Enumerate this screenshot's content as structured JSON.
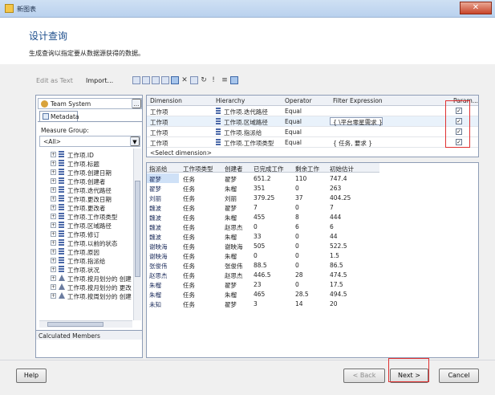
{
  "window": {
    "title": "新图表",
    "close_glyph": "✕"
  },
  "header": {
    "heading": "设计查询",
    "description": "生成查询以指定要从数据源获得的数据。"
  },
  "toolbar": {
    "edit_as_text": "Edit as Text",
    "import": "Import..."
  },
  "left_panel": {
    "cube_selector": "Team System",
    "tab_metadata": "Metadata",
    "measure_group_label": "Measure Group:",
    "measure_group_value": "<All>",
    "tree_items": [
      {
        "label": "工作项.ID",
        "icon": "hierarchy-icon"
      },
      {
        "label": "工作项.标题",
        "icon": "hierarchy-icon"
      },
      {
        "label": "工作项.创建日期",
        "icon": "hierarchy-icon"
      },
      {
        "label": "工作项.创建者",
        "icon": "hierarchy-icon"
      },
      {
        "label": "工作项.迭代路径",
        "icon": "hierarchy-icon"
      },
      {
        "label": "工作项.更改日期",
        "icon": "hierarchy-icon"
      },
      {
        "label": "工作项.更改者",
        "icon": "hierarchy-icon"
      },
      {
        "label": "工作项.工作项类型",
        "icon": "hierarchy-icon"
      },
      {
        "label": "工作项.区域路径",
        "icon": "hierarchy-icon"
      },
      {
        "label": "工作项.修订",
        "icon": "hierarchy-icon"
      },
      {
        "label": "工作项.以前的状态",
        "icon": "hierarchy-icon"
      },
      {
        "label": "工作项.原因",
        "icon": "hierarchy-icon"
      },
      {
        "label": "工作项.指派给",
        "icon": "hierarchy-icon"
      },
      {
        "label": "工作项.状况",
        "icon": "hierarchy-icon"
      },
      {
        "label": "工作项.按月划分的 创建",
        "icon": "triangle-icon"
      },
      {
        "label": "工作项.按月划分的 更改",
        "icon": "triangle-icon"
      },
      {
        "label": "工作项.按周划分的 创建",
        "icon": "triangle-icon"
      }
    ],
    "calculated_members": "Calculated Members"
  },
  "filter_pane": {
    "columns": [
      "Dimension",
      "Hierarchy",
      "Operator",
      "Filter Expression",
      "Param..."
    ],
    "rows": [
      {
        "dimension": "工作项",
        "hierarchy": "工作项.迭代路径",
        "operator": "Equal",
        "expression": "",
        "param": true
      },
      {
        "dimension": "工作项",
        "hierarchy": "工作项.区域路径",
        "operator": "Equal",
        "expression": "{ \\平台零星需求 }",
        "param": true
      },
      {
        "dimension": "工作项",
        "hierarchy": "工作项.指派给",
        "operator": "Equal",
        "expression": "",
        "param": true
      },
      {
        "dimension": "工作项",
        "hierarchy": "工作项.工作项类型",
        "operator": "Equal",
        "expression": "{ 任务, 要求 }",
        "param": true
      }
    ],
    "select_dimension": "<Select dimension>"
  },
  "data_grid": {
    "columns": [
      "指派给",
      "工作项类型",
      "创建者",
      "已完成工作",
      "剩余工作",
      "初始估计"
    ],
    "rows": [
      [
        "翟梦",
        "任务",
        "翟梦",
        "651.2",
        "110",
        "747.4"
      ],
      [
        "翟梦",
        "任务",
        "朱榴",
        "351",
        "0",
        "263"
      ],
      [
        "刘丽",
        "任务",
        "刘丽",
        "379.25",
        "37",
        "404.25"
      ],
      [
        "魏波",
        "任务",
        "翟梦",
        "7",
        "0",
        "7"
      ],
      [
        "魏波",
        "任务",
        "朱榴",
        "455",
        "8",
        "444"
      ],
      [
        "魏波",
        "任务",
        "赵思杰",
        "0",
        "6",
        "6"
      ],
      [
        "魏波",
        "任务",
        "朱榴",
        "33",
        "0",
        "44"
      ],
      [
        "谢映海",
        "任务",
        "谢映海",
        "505",
        "0",
        "522.5"
      ],
      [
        "谢映海",
        "任务",
        "朱榴",
        "0",
        "0",
        "1.5"
      ],
      [
        "张俊伟",
        "任务",
        "张俊伟",
        "88.5",
        "0",
        "86.5"
      ],
      [
        "赵思杰",
        "任务",
        "赵思杰",
        "446.5",
        "28",
        "474.5"
      ],
      [
        "朱榴",
        "任务",
        "翟梦",
        "23",
        "0",
        "17.5"
      ],
      [
        "朱榴",
        "任务",
        "朱榴",
        "465",
        "28.5",
        "494.5"
      ],
      [
        "未知",
        "任务",
        "翟梦",
        "3",
        "14",
        "20"
      ]
    ]
  },
  "footer": {
    "help": "Help",
    "back": "< Back",
    "next": "Next >",
    "cancel": "Cancel"
  }
}
